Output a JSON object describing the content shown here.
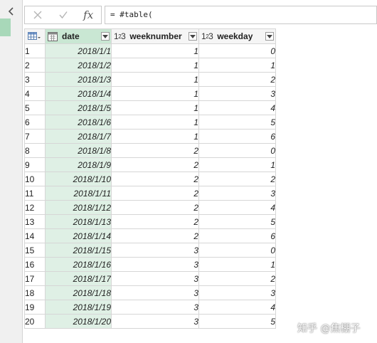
{
  "formula_bar": {
    "cancel_icon": "close-icon",
    "confirm_icon": "check-icon",
    "fx_label": "fx",
    "formula": "= #table("
  },
  "table": {
    "columns": [
      {
        "name": "date",
        "type_icon": "date-type-icon"
      },
      {
        "name": "weeknumber",
        "type_icon": "number-type-icon",
        "type_label": "1²3"
      },
      {
        "name": "weekday",
        "type_icon": "number-type-icon",
        "type_label": "1²3"
      }
    ],
    "rows": [
      {
        "n": "1",
        "date": "2018/1/1",
        "weeknumber": "1",
        "weekday": "0"
      },
      {
        "n": "2",
        "date": "2018/1/2",
        "weeknumber": "1",
        "weekday": "1"
      },
      {
        "n": "3",
        "date": "2018/1/3",
        "weeknumber": "1",
        "weekday": "2"
      },
      {
        "n": "4",
        "date": "2018/1/4",
        "weeknumber": "1",
        "weekday": "3"
      },
      {
        "n": "5",
        "date": "2018/1/5",
        "weeknumber": "1",
        "weekday": "4"
      },
      {
        "n": "6",
        "date": "2018/1/6",
        "weeknumber": "1",
        "weekday": "5"
      },
      {
        "n": "7",
        "date": "2018/1/7",
        "weeknumber": "1",
        "weekday": "6"
      },
      {
        "n": "8",
        "date": "2018/1/8",
        "weeknumber": "2",
        "weekday": "0"
      },
      {
        "n": "9",
        "date": "2018/1/9",
        "weeknumber": "2",
        "weekday": "1"
      },
      {
        "n": "10",
        "date": "2018/1/10",
        "weeknumber": "2",
        "weekday": "2"
      },
      {
        "n": "11",
        "date": "2018/1/11",
        "weeknumber": "2",
        "weekday": "3"
      },
      {
        "n": "12",
        "date": "2018/1/12",
        "weeknumber": "2",
        "weekday": "4"
      },
      {
        "n": "13",
        "date": "2018/1/13",
        "weeknumber": "2",
        "weekday": "5"
      },
      {
        "n": "14",
        "date": "2018/1/14",
        "weeknumber": "2",
        "weekday": "6"
      },
      {
        "n": "15",
        "date": "2018/1/15",
        "weeknumber": "3",
        "weekday": "0"
      },
      {
        "n": "16",
        "date": "2018/1/16",
        "weeknumber": "3",
        "weekday": "1"
      },
      {
        "n": "17",
        "date": "2018/1/17",
        "weeknumber": "3",
        "weekday": "2"
      },
      {
        "n": "18",
        "date": "2018/1/18",
        "weeknumber": "3",
        "weekday": "3"
      },
      {
        "n": "19",
        "date": "2018/1/19",
        "weeknumber": "3",
        "weekday": "4"
      },
      {
        "n": "20",
        "date": "2018/1/20",
        "weeknumber": "3",
        "weekday": "5"
      }
    ]
  },
  "watermark": "知乎 @焦棚子",
  "colors": {
    "selected_column": "#dff0e5",
    "selected_header": "#c9e7d3",
    "query_marker": "#a8d8b9"
  }
}
